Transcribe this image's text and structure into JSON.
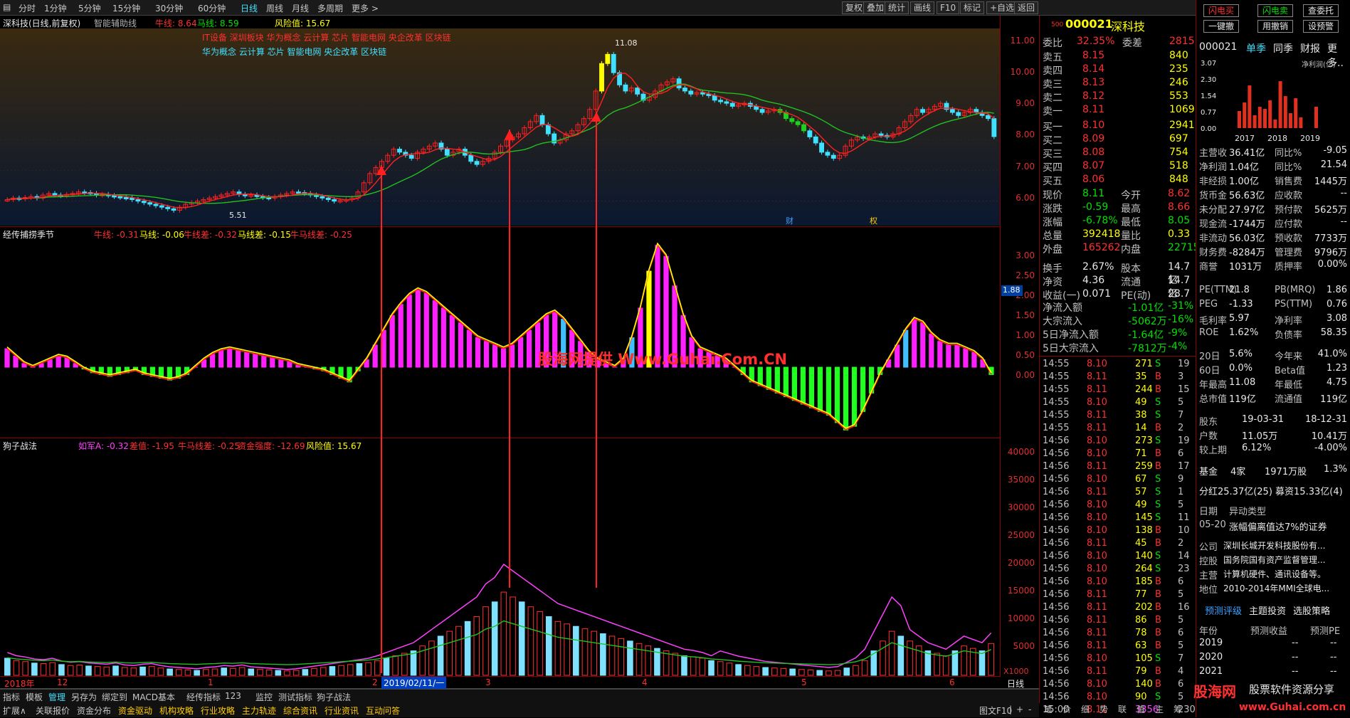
{
  "toolbar": {
    "items": [
      "分时",
      "1分钟",
      "5分钟",
      "15分钟",
      "30分钟",
      "60分钟",
      "日线",
      "周线",
      "月线",
      "多周期",
      "更多 >"
    ],
    "active": "日线",
    "right": [
      "复权",
      "叠加",
      "统计",
      "画线",
      "F10",
      "标记",
      "+自选",
      "返回"
    ]
  },
  "main": {
    "stock": "深科技(日线,前复权)",
    "indicator": "智能辅助线",
    "niu_label": "牛线: 8.64",
    "ma_label": "马线: 8.59",
    "risk_label": "风险值: 15.67",
    "concepts1": "IT设备 深圳板块 华为概念 云计算 芯片 智能电网 央企改革 区块链",
    "concepts2": "华为概念 云计算 芯片 智能电网 央企改革 区块链",
    "high_label": "11.08",
    "low_label": "5.51",
    "ticks": [
      "11.00",
      "10.00",
      "9.00",
      "8.00",
      "7.00",
      "6.00"
    ],
    "cai": "财",
    "cai2": "权"
  },
  "pane2": {
    "title": "经传捕捞季节",
    "labels": [
      "牛线: -0.31",
      "马线: -0.06",
      "牛线差: -0.32",
      "马线差: -0.15",
      "牛马线差: -0.25"
    ],
    "ticks": [
      "3.00",
      "2.50",
      "2.00",
      "1.50",
      "1.00",
      "0.50",
      "0.00"
    ],
    "marker": "1.88",
    "watermark": "股海网提供 Www.Guhai.Com.CN"
  },
  "pane3": {
    "title": "狗子战法",
    "labels": [
      "如军A: -0.32",
      "差值: -1.95",
      "牛马线差: -0.25",
      "资金强度: -12.69",
      "风险值: 15.67"
    ],
    "ticks": [
      "40000",
      "35000",
      "30000",
      "25000",
      "20000",
      "15000",
      "10000",
      "5000"
    ],
    "unit": "X1000"
  },
  "xaxis": {
    "labels": [
      "2018年",
      "12",
      "1",
      "2",
      "3",
      "4",
      "5",
      "6"
    ],
    "date": "2019/02/11/一",
    "right": "日线"
  },
  "bottom": {
    "row1": [
      "指标",
      "模板",
      "管理",
      "另存为",
      "绑定到",
      "MACD基本",
      "经传指标",
      "123",
      "监控",
      "测试指标",
      "狗子战法"
    ],
    "row2": [
      "扩展∧",
      "关联报价",
      "资金分布",
      "资金驱动",
      "机构攻略",
      "行业攻略",
      "主力轨迹",
      "综合资讯",
      "行业资讯",
      "互动问答"
    ],
    "right2": [
      "图文F10",
      "|",
      "+",
      "-"
    ]
  },
  "quote": {
    "code": "000021",
    "name": "深科技",
    "sub": "500",
    "weibi": [
      "委比",
      "32.35%",
      "委差",
      "2815"
    ],
    "sells": [
      [
        "卖五",
        "8.15",
        "840"
      ],
      [
        "卖四",
        "8.14",
        "235"
      ],
      [
        "卖三",
        "8.13",
        "246"
      ],
      [
        "卖二",
        "8.12",
        "553"
      ],
      [
        "卖一",
        "8.11",
        "1069"
      ]
    ],
    "buys": [
      [
        "买一",
        "8.10",
        "2941"
      ],
      [
        "买二",
        "8.09",
        "697"
      ],
      [
        "买三",
        "8.08",
        "754"
      ],
      [
        "买四",
        "8.07",
        "518"
      ],
      [
        "买五",
        "8.06",
        "848"
      ]
    ],
    "stats": [
      [
        "现价",
        "8.11",
        "今开",
        "8.62"
      ],
      [
        "涨跌",
        "-0.59",
        "最高",
        "8.66"
      ],
      [
        "涨幅",
        "-6.78%",
        "最低",
        "8.05"
      ],
      [
        "总量",
        "392418",
        "量比",
        "0.33"
      ],
      [
        "外盘",
        "165262",
        "内盘",
        "227155"
      ],
      [
        "换手",
        "2.67%",
        "股本",
        "14.7亿"
      ],
      [
        "净资",
        "4.36",
        "流通",
        "14.7亿"
      ],
      [
        "收益(一)",
        "0.071",
        "PE(动)",
        "28.7"
      ]
    ],
    "flows": [
      [
        "净流入额",
        "-1.01亿",
        "-31%"
      ],
      [
        "大宗流入",
        "-5062万",
        "-16%"
      ],
      [
        "5日净流入额",
        "-1.64亿",
        "-9%"
      ],
      [
        "5日大宗流入",
        "-7812万",
        "-4%"
      ]
    ],
    "ticks": [
      [
        "14:55",
        "8.10",
        "271",
        "S",
        "19"
      ],
      [
        "14:55",
        "8.11",
        "35",
        "B",
        "3"
      ],
      [
        "14:55",
        "8.11",
        "244",
        "B",
        "15"
      ],
      [
        "14:55",
        "8.10",
        "49",
        "S",
        "5"
      ],
      [
        "14:55",
        "8.11",
        "38",
        "S",
        "7"
      ],
      [
        "14:55",
        "8.11",
        "14",
        "B",
        "2"
      ],
      [
        "14:56",
        "8.10",
        "273",
        "S",
        "19"
      ],
      [
        "14:56",
        "8.10",
        "71",
        "B",
        "6"
      ],
      [
        "14:56",
        "8.11",
        "259",
        "B",
        "17"
      ],
      [
        "14:56",
        "8.10",
        "67",
        "S",
        "9"
      ],
      [
        "14:56",
        "8.11",
        "57",
        "S",
        "1"
      ],
      [
        "14:56",
        "8.10",
        "49",
        "S",
        "5"
      ],
      [
        "14:56",
        "8.10",
        "145",
        "S",
        "11"
      ],
      [
        "14:56",
        "8.10",
        "138",
        "B",
        "10"
      ],
      [
        "14:56",
        "8.11",
        "45",
        "B",
        "2"
      ],
      [
        "14:56",
        "8.10",
        "140",
        "S",
        "14"
      ],
      [
        "14:56",
        "8.10",
        "264",
        "S",
        "23"
      ],
      [
        "14:56",
        "8.10",
        "185",
        "B",
        "6"
      ],
      [
        "14:56",
        "8.11",
        "77",
        "B",
        "5"
      ],
      [
        "14:56",
        "8.11",
        "202",
        "B",
        "16"
      ],
      [
        "14:56",
        "8.11",
        "86",
        "B",
        "5"
      ],
      [
        "14:56",
        "8.11",
        "78",
        "B",
        "6"
      ],
      [
        "14:56",
        "8.11",
        "63",
        "B",
        "5"
      ],
      [
        "14:56",
        "8.10",
        "105",
        "S",
        "7"
      ],
      [
        "14:56",
        "8.11",
        "79",
        "B",
        "4"
      ],
      [
        "14:56",
        "8.10",
        "140",
        "B",
        "6"
      ],
      [
        "14:56",
        "8.10",
        "90",
        "S",
        "5"
      ],
      [
        "15:00",
        "8.11",
        "3356",
        "",
        "230"
      ]
    ],
    "tabs": [
      "笔",
      "价",
      "细",
      "势",
      "联",
      "值",
      "主",
      "筹"
    ]
  },
  "right": {
    "btn": [
      "闪电买",
      "闪电卖",
      "查委托",
      "一键撤",
      "用撤销",
      "设预警"
    ],
    "code": "000021",
    "tabs": [
      "单季",
      "同季",
      "财报",
      "更多.."
    ],
    "chart_title": "净利润(亿)",
    "yticks": [
      "3.07",
      "2.30",
      "1.54",
      "0.77",
      "0.00"
    ],
    "years": [
      "2017",
      "2018",
      "2019"
    ],
    "fin": [
      [
        "主营收",
        "36.41亿",
        "同比%",
        "-9.05"
      ],
      [
        "净利润",
        "1.04亿",
        "同比%",
        "21.54"
      ],
      [
        "非经损",
        "1.00亿",
        "销售费",
        "1445万"
      ],
      [
        "货币金",
        "56.63亿",
        "应收款",
        "--"
      ],
      [
        "未分配",
        "27.97亿",
        "预付款",
        "5625万"
      ],
      [
        "现金流",
        "-1744万",
        "应付款",
        "--"
      ],
      [
        "非流动",
        "56.03亿",
        "预收款",
        "7733万"
      ],
      [
        "财务费",
        "-8284万",
        "管理费",
        "9796万"
      ],
      [
        "商誉",
        "1031万",
        "质押率",
        "0.00%"
      ]
    ],
    "val": [
      [
        "PE(TTM)",
        "21.8",
        "PB(MRQ)",
        "1.86"
      ],
      [
        "PEG",
        "-1.33",
        "PS(TTM)",
        "0.76"
      ],
      [
        "毛利率",
        "5.97",
        "净利率",
        "3.08"
      ],
      [
        "ROE",
        "1.62%",
        "负债率",
        "58.35"
      ]
    ],
    "perf": [
      [
        "20日",
        "5.6%",
        "今年来",
        "41.0%"
      ],
      [
        "60日",
        "0.0%",
        "Beta值",
        "1.23"
      ],
      [
        "年最高",
        "11.08",
        "年最低",
        "4.75"
      ],
      [
        "总市值",
        "119亿",
        "流通值",
        "119亿"
      ]
    ],
    "holders": [
      [
        "股东",
        "19-03-31",
        "18-12-31"
      ],
      [
        "户数",
        "11.05万",
        "10.41万"
      ],
      [
        "较上期",
        "6.12%",
        "-4.00%"
      ]
    ],
    "fund": [
      "基金",
      "4家",
      "1971万股",
      "1.3%"
    ],
    "div": "分红25.37亿(25) 募资15.33亿(4)",
    "events": [
      [
        "日期",
        "异动类型"
      ],
      [
        "05-20",
        "涨幅偏离值达7%的证券"
      ]
    ],
    "company": [
      [
        "公司",
        "深圳长城开发科技股份有..."
      ],
      [
        "控股",
        "国务院国有资产监督管理..."
      ],
      [
        "主营",
        "计算机硬件、通讯设备等。"
      ],
      [
        "地位",
        "2010-2014年MMI全球电..."
      ]
    ],
    "ftabs": [
      "预测评级",
      "主题投资",
      "选股策略"
    ],
    "forecast_head": [
      "年份",
      "预测收益",
      "预测PE"
    ],
    "forecast": [
      [
        "2019",
        "--",
        "--"
      ],
      [
        "2020",
        "--",
        "--"
      ],
      [
        "2021",
        "--",
        "--"
      ]
    ],
    "logo": "股海网",
    "logo2": "股票软件资源分享",
    "url": "www.Guhai.com.cn"
  },
  "chart_data": [
    {
      "type": "candlestick",
      "title": "深科技(日线,前复权)",
      "ylim": [
        5.2,
        11.6
      ],
      "series": [
        {
          "name": "牛线",
          "color": "#ff2020"
        },
        {
          "name": "马线",
          "color": "#20c020"
        }
      ],
      "close": [
        6.05,
        6.1,
        6.08,
        6.12,
        6.15,
        6.1,
        6.2,
        6.25,
        6.2,
        6.18,
        6.22,
        6.25,
        6.3,
        6.28,
        6.25,
        6.2,
        6.22,
        6.18,
        6.15,
        6.12,
        6.1,
        6.05,
        6.0,
        5.95,
        5.9,
        5.85,
        5.8,
        5.75,
        5.7,
        5.8,
        5.9,
        5.95,
        6.0,
        6.05,
        6.1,
        6.15,
        6.2,
        6.25,
        6.3,
        6.22,
        6.18,
        6.2,
        6.15,
        6.12,
        6.1,
        6.15,
        6.2,
        6.25,
        6.3,
        6.28,
        6.25,
        6.2,
        6.15,
        6.1,
        6.05,
        6.0,
        6.02,
        6.05,
        6.1,
        6.3,
        6.6,
        6.9,
        7.1,
        7.3,
        7.5,
        7.7,
        7.6,
        7.5,
        7.4,
        7.6,
        7.7,
        7.8,
        7.9,
        7.7,
        7.5,
        7.6,
        7.7,
        7.5,
        7.3,
        7.2,
        7.3,
        7.4,
        7.6,
        7.8,
        8.0,
        8.1,
        8.2,
        8.4,
        8.6,
        8.8,
        8.5,
        8.2,
        7.9,
        8.0,
        8.2,
        8.3,
        8.5,
        8.7,
        9.0,
        9.6,
        10.5,
        10.8,
        10.2,
        9.8,
        9.6,
        9.7,
        9.5,
        9.3,
        9.4,
        9.6,
        9.8,
        9.9,
        10.0,
        9.7,
        9.6,
        9.5,
        9.55,
        9.5,
        9.45,
        9.3,
        9.25,
        9.2,
        9.1,
        9.15,
        9.2,
        9.1,
        9.0,
        8.9,
        8.95,
        9.0,
        8.9,
        8.7,
        8.6,
        8.5,
        8.3,
        8.1,
        7.9,
        7.6,
        7.5,
        7.4,
        7.5,
        7.8,
        8.0,
        8.1,
        8.05,
        8.1,
        8.2,
        8.15,
        8.1,
        8.2,
        8.4,
        8.6,
        8.8,
        9.0,
        8.9,
        9.0,
        9.1,
        9.2,
        9.0,
        8.9,
        8.8,
        8.9,
        9.0,
        8.9,
        8.8,
        8.7,
        8.11
      ]
    },
    {
      "type": "bar",
      "title": "经传捕捞季节",
      "ylim": [
        -1.8,
        3.4
      ],
      "series": [
        {
          "name": "牛线"
        },
        {
          "name": "马线"
        }
      ],
      "values": [
        0.5,
        0.3,
        0.1,
        0.0,
        0.1,
        0.2,
        0.3,
        0.25,
        0.1,
        -0.05,
        -0.15,
        -0.2,
        -0.25,
        -0.2,
        -0.15,
        -0.1,
        -0.2,
        -0.25,
        -0.3,
        -0.35,
        -0.3,
        -0.2,
        0.0,
        0.2,
        0.35,
        0.45,
        0.5,
        0.45,
        0.4,
        0.35,
        0.3,
        0.25,
        0.2,
        0.15,
        0.05,
        0.0,
        -0.05,
        -0.1,
        -0.2,
        -0.3,
        -0.4,
        -0.1,
        0.2,
        0.6,
        1.0,
        1.4,
        1.7,
        1.95,
        2.1,
        2.0,
        1.8,
        1.6,
        1.4,
        1.2,
        1.0,
        0.8,
        0.7,
        0.6,
        0.5,
        0.6,
        0.8,
        1.0,
        1.2,
        1.4,
        1.5,
        1.3,
        1.0,
        0.7,
        0.4,
        0.2,
        0.1,
        0.0,
        0.2,
        0.8,
        1.6,
        2.6,
        3.3,
        3.0,
        2.2,
        1.4,
        0.8,
        0.5,
        0.4,
        0.3,
        0.2,
        0.0,
        -0.2,
        -0.4,
        -0.5,
        -0.6,
        -0.7,
        -0.8,
        -0.9,
        -1.0,
        -1.1,
        -1.2,
        -1.3,
        -1.5,
        -1.7,
        -1.6,
        -1.2,
        -0.7,
        -0.2,
        0.2,
        0.6,
        1.0,
        1.3,
        1.2,
        0.9,
        0.7,
        0.6,
        0.6,
        0.5,
        0.4,
        0.2,
        -0.2
      ]
    },
    {
      "type": "bar",
      "title": "狗子战法",
      "ylim": [
        0,
        42000
      ],
      "series": [
        {
          "name": "如军A",
          "color": "#ff40ff"
        },
        {
          "name": "资金强度",
          "color": "#20c020"
        }
      ],
      "values": [
        3500,
        3000,
        2800,
        2500,
        2400,
        2600,
        2200,
        2000,
        2100,
        1900,
        1800,
        1700,
        1900,
        1600,
        1500,
        1700,
        1800,
        1500,
        1300,
        1200,
        1100,
        1000,
        1200,
        1300,
        1500,
        1400,
        1600,
        1300,
        1200,
        1100,
        1000,
        900,
        1000,
        1200,
        1400,
        1600,
        1800,
        2000,
        2200,
        2400,
        2600,
        3000,
        3500,
        4000,
        4500,
        5000,
        6000,
        7000,
        8000,
        9000,
        10000,
        11000,
        12000,
        14000,
        15000,
        17000,
        16000,
        15000,
        14000,
        13000,
        12000,
        11000,
        10500,
        10000,
        9500,
        9000,
        8500,
        8000,
        7500,
        7000,
        6500,
        6000,
        5500,
        5000,
        4500,
        4000,
        3800,
        3500,
        3000,
        2800,
        2500,
        2200,
        2000,
        1800,
        1600,
        1500,
        1400,
        1300,
        1200,
        1100,
        1000,
        900,
        1000,
        1500,
        2000,
        3000,
        5000,
        7000,
        9000,
        8000,
        7000,
        6000,
        5000,
        4500,
        4000,
        5000,
        6000,
        5500,
        5000,
        6500
      ]
    }
  ]
}
